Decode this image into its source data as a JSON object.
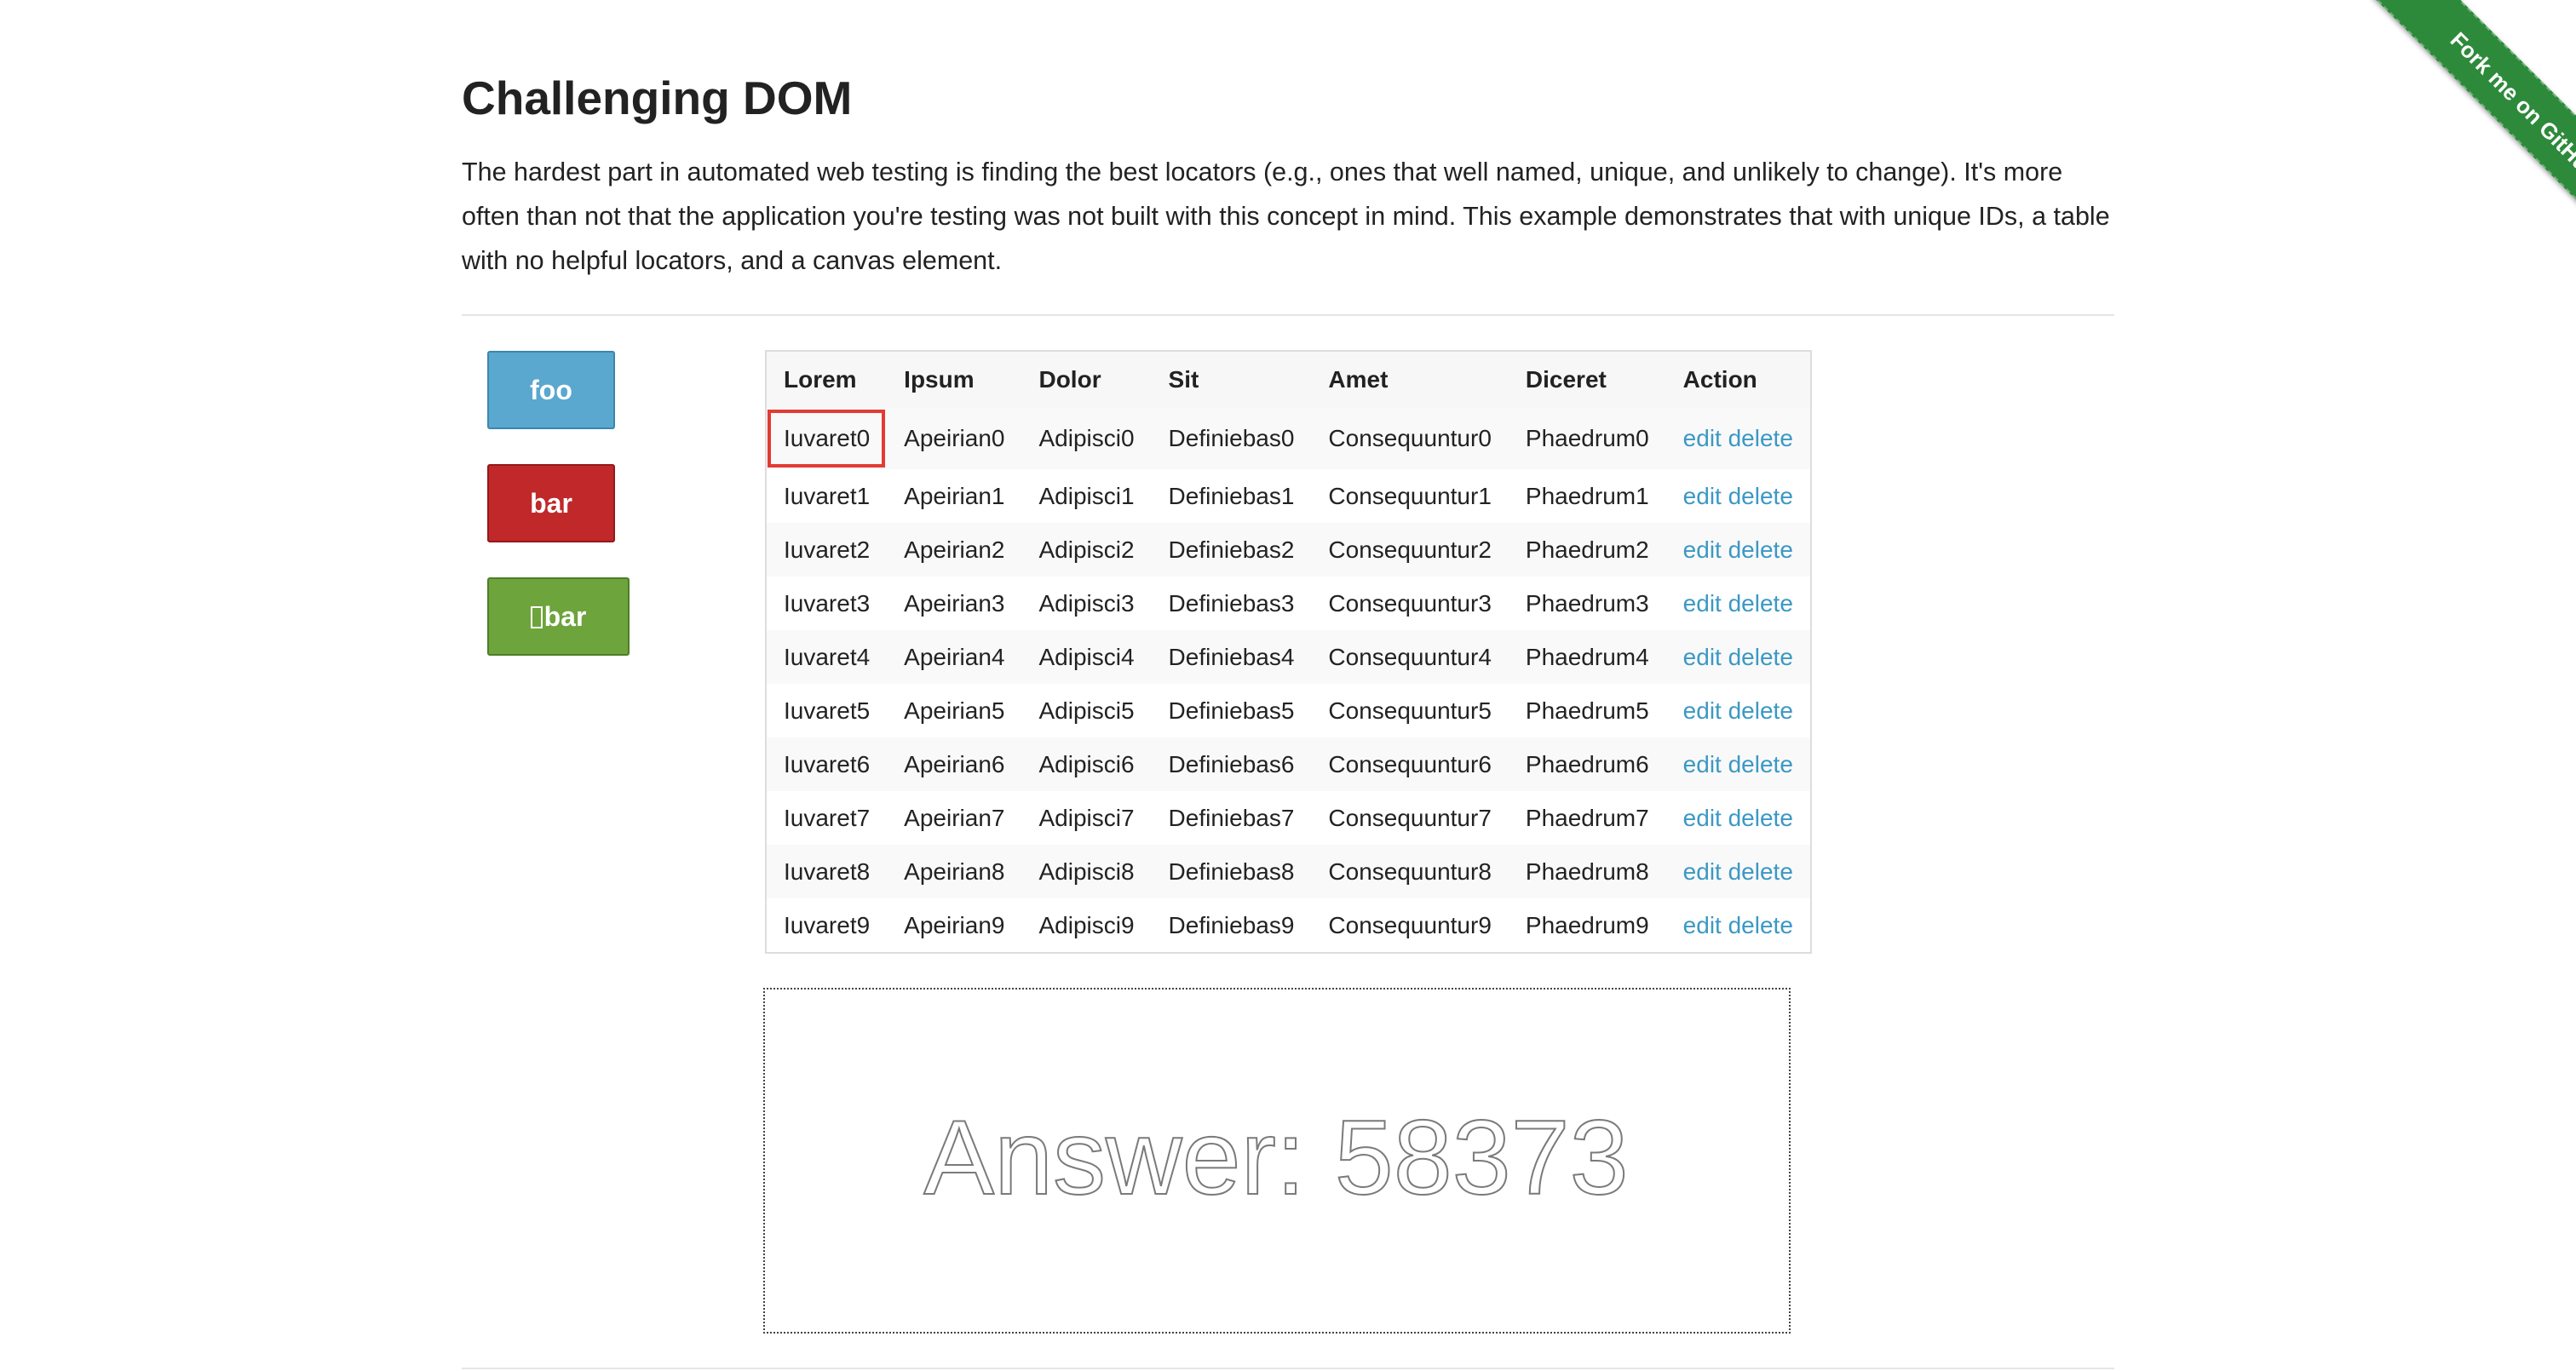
{
  "page": {
    "title": "Challenging DOM",
    "intro": "The hardest part in automated web testing is finding the best locators (e.g., ones that well named, unique, and unlikely to change). It's more often than not that the application you're testing was not built with this concept in mind. This example demonstrates that with unique IDs, a table with no helpful locators, and a canvas element."
  },
  "buttons": {
    "foo_label": "foo",
    "bar_label": "bar",
    "qux_label": "\u0000bar"
  },
  "colors": {
    "foo": "#5aa7cf",
    "bar": "#c0282a",
    "qux": "#6da43c",
    "link": "#3b98c4",
    "ribbon": "#2d8a3a",
    "highlight": "#e23b33"
  },
  "table": {
    "headers": [
      "Lorem",
      "Ipsum",
      "Dolor",
      "Sit",
      "Amet",
      "Diceret",
      "Action"
    ],
    "rows": [
      [
        "Iuvaret0",
        "Apeirian0",
        "Adipisci0",
        "Definiebas0",
        "Consequuntur0",
        "Phaedrum0"
      ],
      [
        "Iuvaret1",
        "Apeirian1",
        "Adipisci1",
        "Definiebas1",
        "Consequuntur1",
        "Phaedrum1"
      ],
      [
        "Iuvaret2",
        "Apeirian2",
        "Adipisci2",
        "Definiebas2",
        "Consequuntur2",
        "Phaedrum2"
      ],
      [
        "Iuvaret3",
        "Apeirian3",
        "Adipisci3",
        "Definiebas3",
        "Consequuntur3",
        "Phaedrum3"
      ],
      [
        "Iuvaret4",
        "Apeirian4",
        "Adipisci4",
        "Definiebas4",
        "Consequuntur4",
        "Phaedrum4"
      ],
      [
        "Iuvaret5",
        "Apeirian5",
        "Adipisci5",
        "Definiebas5",
        "Consequuntur5",
        "Phaedrum5"
      ],
      [
        "Iuvaret6",
        "Apeirian6",
        "Adipisci6",
        "Definiebas6",
        "Consequuntur6",
        "Phaedrum6"
      ],
      [
        "Iuvaret7",
        "Apeirian7",
        "Adipisci7",
        "Definiebas7",
        "Consequuntur7",
        "Phaedrum7"
      ],
      [
        "Iuvaret8",
        "Apeirian8",
        "Adipisci8",
        "Definiebas8",
        "Consequuntur8",
        "Phaedrum8"
      ],
      [
        "Iuvaret9",
        "Apeirian9",
        "Adipisci9",
        "Definiebas9",
        "Consequuntur9",
        "Phaedrum9"
      ]
    ],
    "edit_label": "edit",
    "delete_label": "delete"
  },
  "canvas": {
    "answer_text": "Answer: 58373"
  },
  "ribbon": {
    "label": "Fork me on GitHub"
  }
}
